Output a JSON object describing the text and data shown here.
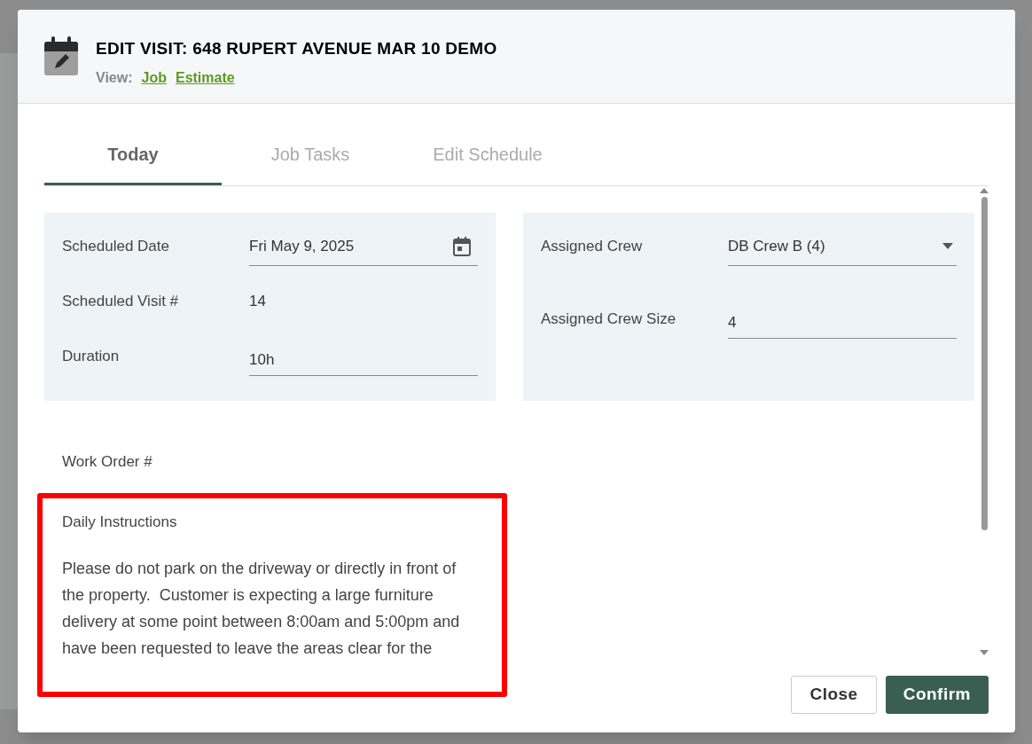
{
  "dialog": {
    "title": "EDIT VISIT: 648 RUPERT AVENUE MAR 10 DEMO",
    "view_label": "View:",
    "view_links": [
      "Job",
      "Estimate"
    ]
  },
  "tabs": [
    {
      "label": "Today",
      "selected": true
    },
    {
      "label": "Job Tasks",
      "selected": false
    },
    {
      "label": "Edit Schedule",
      "selected": false
    }
  ],
  "schedule_panel": [
    {
      "kind": "date",
      "label": "Scheduled Date",
      "value": "Fri May 9, 2025"
    },
    {
      "kind": "text",
      "label": "Scheduled Visit #",
      "value": "14"
    },
    {
      "kind": "input",
      "label": "Duration",
      "value": "10h"
    }
  ],
  "crew_panel": [
    {
      "kind": "select",
      "label": "Assigned Crew",
      "value": "DB Crew B (4)"
    },
    {
      "kind": "input",
      "label": "Assigned Crew Size",
      "value": "4"
    }
  ],
  "work_order_label": "Work Order #",
  "daily_instructions": {
    "label": "Daily Instructions",
    "text": "Please do not park on the driveway or directly in front of the property.  Customer is expecting a large furniture delivery at some point between 8:00am and 5:00pm and have been requested to leave the areas clear for the"
  },
  "buttons": [
    "Close",
    "Confirm"
  ]
}
